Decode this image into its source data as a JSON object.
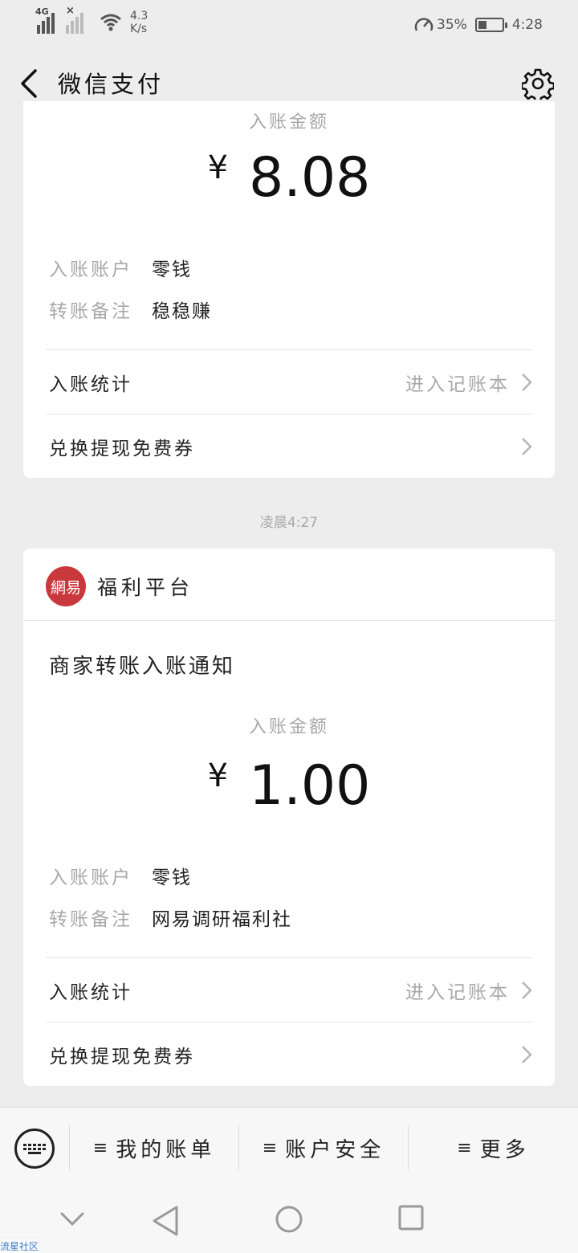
{
  "status_bar": {
    "network_type": "4G",
    "net_speed_value": "4.3",
    "net_speed_unit": "K/s",
    "battery_percent": "35%",
    "battery_level": 0.35,
    "time": "4:28"
  },
  "nav": {
    "title": "微信支付"
  },
  "card1": {
    "amount_label": "入账金额",
    "currency": "¥",
    "amount": "8.08",
    "account_label": "入账账户",
    "account_value": "零钱",
    "remark_label": "转账备注",
    "remark_value": "稳稳赚",
    "stats_label": "入账统计",
    "stats_hint": "进入记账本",
    "coupon_label": "兑换提现免费券"
  },
  "time_label": "凌晨4:27",
  "card2": {
    "brand_logo_text": "網易",
    "brand_name": "福利平台",
    "notice_title": "商家转账入账通知",
    "amount_label": "入账金额",
    "currency": "¥",
    "amount": "1.00",
    "account_label": "入账账户",
    "account_value": "零钱",
    "remark_label": "转账备注",
    "remark_value": "网易调研福利社",
    "stats_label": "入账统计",
    "stats_hint": "进入记账本",
    "coupon_label": "兑换提现免费券"
  },
  "bottom_menu": {
    "item1": "我的账单",
    "item2": "账户安全",
    "item3": "更多",
    "hamburger": "≡"
  },
  "watermark": "流星社区",
  "colors": {
    "background": "#ededed",
    "card": "#ffffff",
    "brand_red": "#c8383c",
    "muted_text": "#a8a8a8"
  }
}
